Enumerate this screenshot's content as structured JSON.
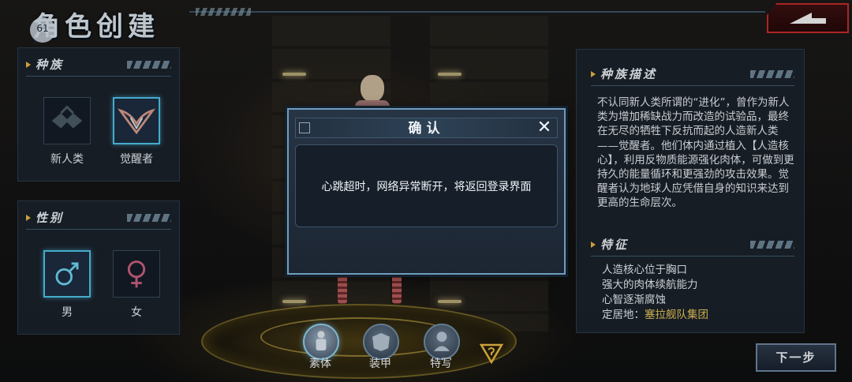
{
  "header": {
    "title": "角色创建",
    "fps": "61",
    "fps_sub": "8"
  },
  "race_panel": {
    "title": "种族",
    "options": [
      {
        "label": "新人类",
        "icon": "new-human-emblem-icon",
        "selected": false
      },
      {
        "label": "觉醒者",
        "icon": "awakened-emblem-icon",
        "selected": true
      }
    ]
  },
  "gender_panel": {
    "title": "性别",
    "options": [
      {
        "label": "男",
        "icon": "male-symbol-icon",
        "selected": true
      },
      {
        "label": "女",
        "icon": "female-symbol-icon",
        "selected": false
      }
    ]
  },
  "description_panel": {
    "title": "种族描述",
    "text": "不认同新人类所谓的“进化”，曾作为新人类为增加稀缺战力而改造的试验品，最终在无尽的牺牲下反抗而起的人造新人类——觉醒者。他们体内通过植入【人造核心】，利用反物质能源强化肉体，可做到更持久的能量循环和更强劲的攻击效果。觉醒者认为地球人应凭借自身的知识来达到更高的生命层次。",
    "features_title": "特征",
    "features": [
      "人造核心位于胸口",
      "强大的肉体续航能力",
      "心智逐渐腐蚀"
    ],
    "location_label": "定居地：",
    "location_value": "塞拉舰队集团"
  },
  "bottom_tabs": [
    {
      "label": "素体",
      "icon": "body-icon",
      "active": true
    },
    {
      "label": "装甲",
      "icon": "armor-icon",
      "active": false
    },
    {
      "label": "特写",
      "icon": "closeup-icon",
      "active": false
    }
  ],
  "next_button": "下一步",
  "dialog": {
    "title": "确认",
    "message": "心跳超时，网络异常断开，将返回登录界面",
    "close_icon": "close-icon"
  },
  "colors": {
    "accent_blue": "#4fc3e8",
    "accent_gold": "#e7b740",
    "back_red": "#c62a2a",
    "highlight_text": "#e7c65a"
  }
}
